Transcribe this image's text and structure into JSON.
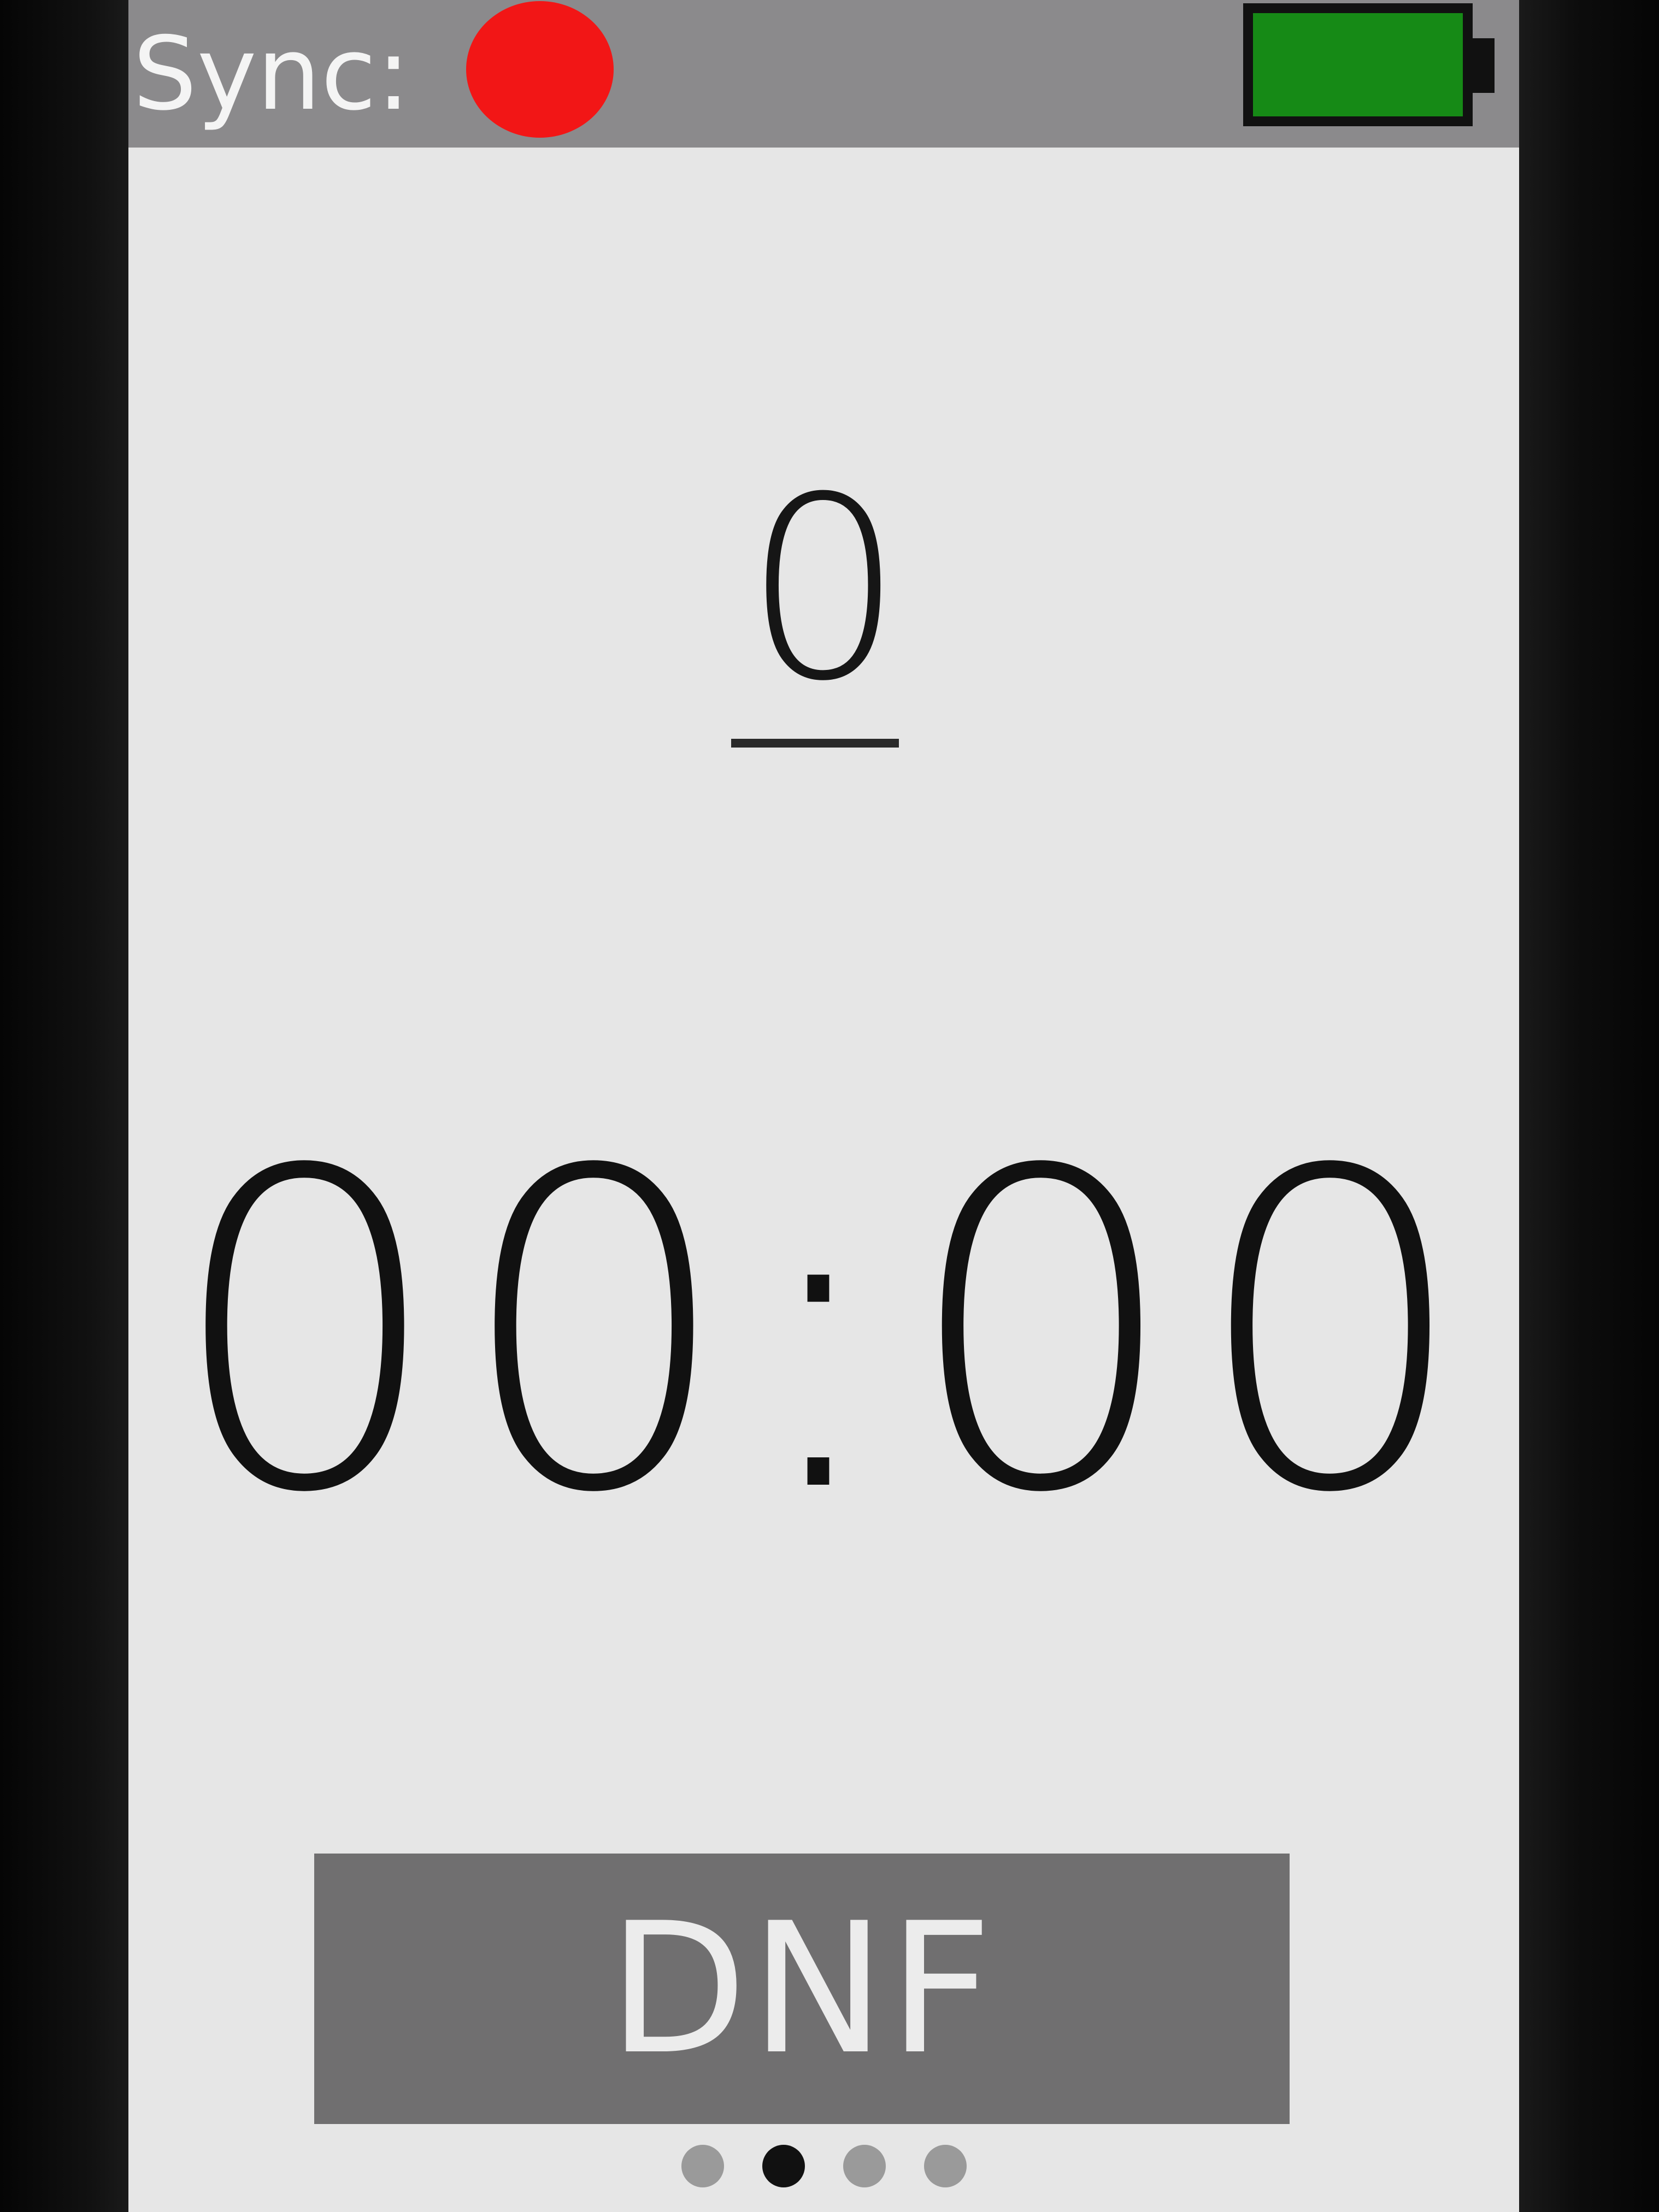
{
  "status_bar": {
    "sync_label": "Sync:",
    "sync_state_color": "#f21616",
    "battery_color": "#168a16",
    "battery_level": 1.0
  },
  "main": {
    "count": "0",
    "timer": "00:00",
    "dnf_label": "DNF"
  },
  "pager": {
    "total": 4,
    "active_index": 1
  },
  "colors": {
    "status_bar_bg": "#8b8a8c",
    "screen_bg": "#e6e6e6",
    "button_bg": "#706f70"
  }
}
